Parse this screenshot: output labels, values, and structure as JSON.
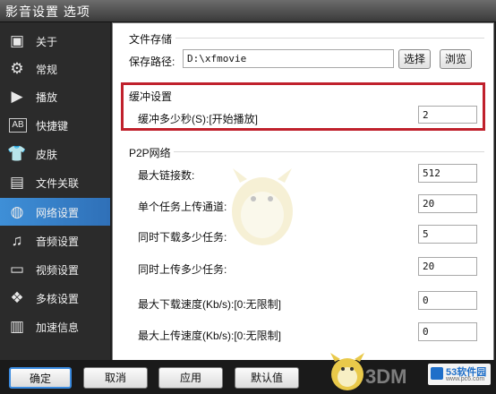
{
  "window": {
    "title": "影音设置 选项"
  },
  "sidebar": {
    "items": [
      {
        "label": "关于",
        "icon": "about-icon"
      },
      {
        "label": "常规",
        "icon": "gear-icon"
      },
      {
        "label": "播放",
        "icon": "play-icon"
      },
      {
        "label": "快捷键",
        "icon": "keyboard-icon"
      },
      {
        "label": "皮肤",
        "icon": "shirt-icon"
      },
      {
        "label": "文件关联",
        "icon": "folder-icon"
      },
      {
        "label": "网络设置",
        "icon": "globe-icon"
      },
      {
        "label": "音频设置",
        "icon": "audio-icon"
      },
      {
        "label": "视频设置",
        "icon": "tv-icon"
      },
      {
        "label": "多核设置",
        "icon": "multicore-icon"
      },
      {
        "label": "加速信息",
        "icon": "info-icon"
      }
    ],
    "active_index": 6
  },
  "storage": {
    "section_title": "文件存储",
    "path_label": "保存路径:",
    "path_value": "D:\\xfmovie",
    "choose_label": "选择",
    "browse_label": "浏览"
  },
  "buffer": {
    "section_title": "缓冲设置",
    "seconds_label": "缓冲多少秒(S):[开始播放]",
    "seconds_value": "2"
  },
  "p2p": {
    "section_title": "P2P网络",
    "rows": [
      {
        "label": "最大链接数:",
        "value": "512"
      },
      {
        "label": "单个任务上传通道:",
        "value": "20"
      },
      {
        "label": "同时下载多少任务:",
        "value": "5"
      },
      {
        "label": "同时上传多少任务:",
        "value": "20"
      },
      {
        "label": "最大下载速度(Kb/s):[0:无限制]",
        "value": "0"
      },
      {
        "label": "最大上传速度(Kb/s):[0:无限制]",
        "value": "0"
      }
    ]
  },
  "footer": {
    "ok_label": "确定",
    "cancel_label": "取消",
    "apply_label": "应用",
    "default_label": "默认值"
  },
  "watermark": {
    "text": "3DM",
    "site_logo_text": "53软件园",
    "site_url": "www.pc6.com"
  }
}
